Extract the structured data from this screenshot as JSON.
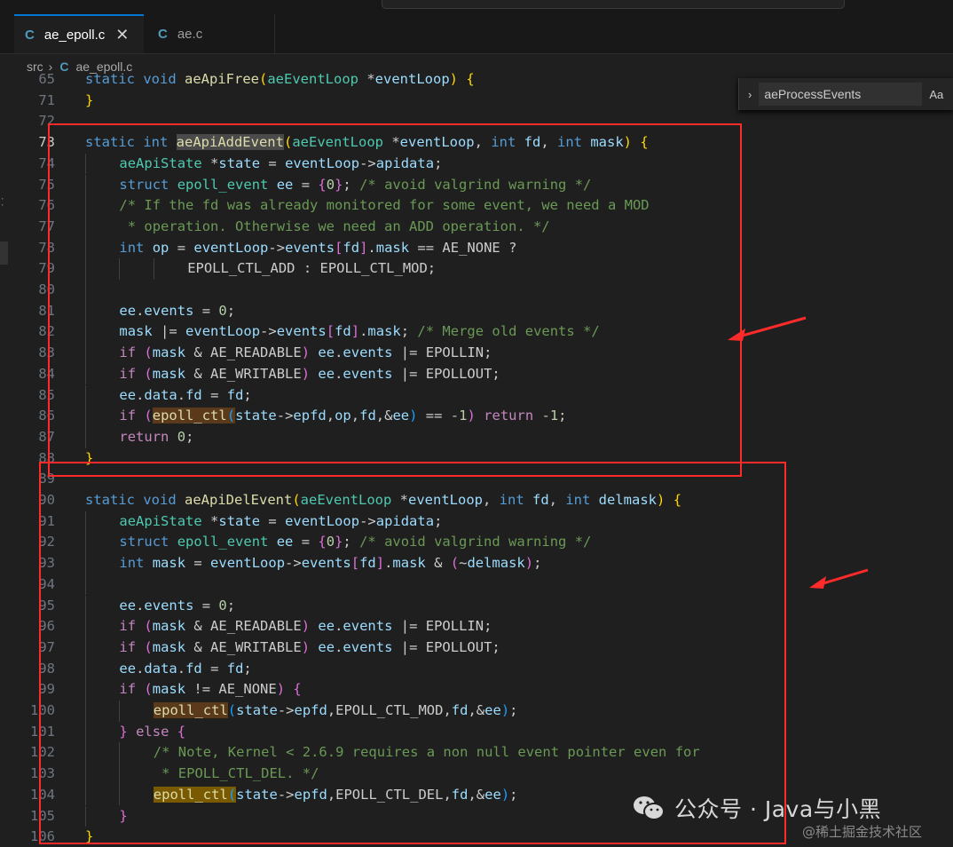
{
  "tabs": [
    {
      "icon": "C",
      "label": "ae_epoll.c",
      "close": "✕"
    },
    {
      "icon": "C",
      "label": "ae.c"
    }
  ],
  "breadcrumb": {
    "folder": "src",
    "file_icon": "C",
    "file": "ae_epoll.c"
  },
  "find_widget": {
    "value": "aeProcessEvents",
    "option": "Aa"
  },
  "watermark": {
    "text": "公众号 · Java与小黑",
    "sub": "@稀土掘金技术社区"
  },
  "colors": {
    "highlight_box": "#ff2b2b",
    "accent": "#0078d4"
  },
  "lines": [
    {
      "n": "65",
      "t": [
        [
          "kw",
          "static "
        ],
        [
          "kw",
          "void "
        ],
        [
          "fn",
          "aeApiFree"
        ],
        [
          "br1",
          "("
        ],
        [
          "ty",
          "aeEventLoop "
        ],
        [
          "ident",
          "*"
        ],
        [
          "var",
          "eventLoop"
        ],
        [
          "br1",
          ")"
        ],
        [
          "ident",
          " "
        ],
        [
          "br1",
          "{"
        ]
      ]
    },
    {
      "n": "71",
      "t": [
        [
          "br1",
          "}"
        ]
      ]
    },
    {
      "n": "72",
      "t": []
    },
    {
      "n": "73",
      "cur": true,
      "t": [
        [
          "kw",
          "static "
        ],
        [
          "kw",
          "int "
        ],
        [
          "fn fnhl",
          "aeApiAddEvent"
        ],
        [
          "br1",
          "("
        ],
        [
          "ty",
          "aeEventLoop "
        ],
        [
          "ident",
          "*"
        ],
        [
          "var",
          "eventLoop"
        ],
        [
          "ident",
          ", "
        ],
        [
          "kw",
          "int "
        ],
        [
          "var",
          "fd"
        ],
        [
          "ident",
          ", "
        ],
        [
          "kw",
          "int "
        ],
        [
          "var",
          "mask"
        ],
        [
          "br1",
          ")"
        ],
        [
          "ident",
          " "
        ],
        [
          "br1",
          "{"
        ]
      ]
    },
    {
      "n": "74",
      "i": 1,
      "t": [
        [
          "ty",
          "aeApiState "
        ],
        [
          "ident",
          "*"
        ],
        [
          "var",
          "state"
        ],
        [
          "ident",
          " = "
        ],
        [
          "var",
          "eventLoop"
        ],
        [
          "ident",
          "->"
        ],
        [
          "var",
          "apidata"
        ],
        [
          "ident",
          ";"
        ]
      ]
    },
    {
      "n": "75",
      "i": 1,
      "t": [
        [
          "kw",
          "struct "
        ],
        [
          "ty",
          "epoll_event "
        ],
        [
          "var",
          "ee"
        ],
        [
          "ident",
          " = "
        ],
        [
          "br2",
          "{"
        ],
        [
          "num",
          "0"
        ],
        [
          "br2",
          "}"
        ],
        [
          "ident",
          "; "
        ],
        [
          "cm",
          "/* avoid valgrind warning */"
        ]
      ]
    },
    {
      "n": "76",
      "i": 1,
      "t": [
        [
          "cm",
          "/* If the fd was already monitored for some event, we need a MOD"
        ]
      ]
    },
    {
      "n": "77",
      "i": 1,
      "t": [
        [
          "cm",
          " * operation. Otherwise we need an ADD operation. */"
        ]
      ]
    },
    {
      "n": "78",
      "i": 1,
      "t": [
        [
          "kw",
          "int "
        ],
        [
          "var",
          "op"
        ],
        [
          "ident",
          " = "
        ],
        [
          "var",
          "eventLoop"
        ],
        [
          "ident",
          "->"
        ],
        [
          "var",
          "events"
        ],
        [
          "br2",
          "["
        ],
        [
          "var",
          "fd"
        ],
        [
          "br2",
          "]"
        ],
        [
          "ident",
          "."
        ],
        [
          "var",
          "mask"
        ],
        [
          "ident",
          " == AE_NONE ?"
        ]
      ]
    },
    {
      "n": "79",
      "i": 3,
      "t": [
        [
          "ident",
          "EPOLL_CTL_ADD : EPOLL_CTL_MOD;"
        ]
      ]
    },
    {
      "n": "80",
      "i": 1,
      "t": []
    },
    {
      "n": "81",
      "i": 1,
      "t": [
        [
          "var",
          "ee"
        ],
        [
          "ident",
          "."
        ],
        [
          "var",
          "events"
        ],
        [
          "ident",
          " = "
        ],
        [
          "num",
          "0"
        ],
        [
          "ident",
          ";"
        ]
      ]
    },
    {
      "n": "82",
      "i": 1,
      "t": [
        [
          "var",
          "mask"
        ],
        [
          "ident",
          " |= "
        ],
        [
          "var",
          "eventLoop"
        ],
        [
          "ident",
          "->"
        ],
        [
          "var",
          "events"
        ],
        [
          "br2",
          "["
        ],
        [
          "var",
          "fd"
        ],
        [
          "br2",
          "]"
        ],
        [
          "ident",
          "."
        ],
        [
          "var",
          "mask"
        ],
        [
          "ident",
          "; "
        ],
        [
          "cm",
          "/* Merge old events */"
        ]
      ]
    },
    {
      "n": "83",
      "i": 1,
      "t": [
        [
          "ctl",
          "if "
        ],
        [
          "br2",
          "("
        ],
        [
          "var",
          "mask"
        ],
        [
          "ident",
          " & AE_READABLE"
        ],
        [
          "br2",
          ")"
        ],
        [
          "ident",
          " "
        ],
        [
          "var",
          "ee"
        ],
        [
          "ident",
          "."
        ],
        [
          "var",
          "events"
        ],
        [
          "ident",
          " |= EPOLLIN;"
        ]
      ]
    },
    {
      "n": "84",
      "i": 1,
      "t": [
        [
          "ctl",
          "if "
        ],
        [
          "br2",
          "("
        ],
        [
          "var",
          "mask"
        ],
        [
          "ident",
          " & AE_WRITABLE"
        ],
        [
          "br2",
          ")"
        ],
        [
          "ident",
          " "
        ],
        [
          "var",
          "ee"
        ],
        [
          "ident",
          "."
        ],
        [
          "var",
          "events"
        ],
        [
          "ident",
          " |= EPOLLOUT;"
        ]
      ]
    },
    {
      "n": "85",
      "i": 1,
      "t": [
        [
          "var",
          "ee"
        ],
        [
          "ident",
          "."
        ],
        [
          "var",
          "data"
        ],
        [
          "ident",
          "."
        ],
        [
          "var",
          "fd"
        ],
        [
          "ident",
          " = "
        ],
        [
          "var",
          "fd"
        ],
        [
          "ident",
          ";"
        ]
      ]
    },
    {
      "n": "86",
      "i": 1,
      "t": [
        [
          "ctl",
          "if "
        ],
        [
          "br2",
          "("
        ],
        [
          "fn brown",
          "epoll_ctl"
        ],
        [
          "br3 brown",
          "("
        ],
        [
          "var",
          "state"
        ],
        [
          "ident",
          "->"
        ],
        [
          "var",
          "epfd"
        ],
        [
          "ident",
          ","
        ],
        [
          "var",
          "op"
        ],
        [
          "ident",
          ","
        ],
        [
          "var",
          "fd"
        ],
        [
          "ident",
          ",&"
        ],
        [
          "var",
          "ee"
        ],
        [
          "br3",
          ")"
        ],
        [
          "ident",
          " == "
        ],
        [
          "num",
          "-1"
        ],
        [
          "br2",
          ")"
        ],
        [
          "ident",
          " "
        ],
        [
          "ctl",
          "return "
        ],
        [
          "num",
          "-1"
        ],
        [
          "ident",
          ";"
        ]
      ]
    },
    {
      "n": "87",
      "i": 1,
      "t": [
        [
          "ctl",
          "return "
        ],
        [
          "num",
          "0"
        ],
        [
          "ident",
          ";"
        ]
      ]
    },
    {
      "n": "88",
      "t": [
        [
          "br1",
          "}"
        ]
      ]
    },
    {
      "n": "89",
      "t": []
    },
    {
      "n": "90",
      "t": [
        [
          "kw",
          "static "
        ],
        [
          "kw",
          "void "
        ],
        [
          "fn",
          "aeApiDelEvent"
        ],
        [
          "br1",
          "("
        ],
        [
          "ty",
          "aeEventLoop "
        ],
        [
          "ident",
          "*"
        ],
        [
          "var",
          "eventLoop"
        ],
        [
          "ident",
          ", "
        ],
        [
          "kw",
          "int "
        ],
        [
          "var",
          "fd"
        ],
        [
          "ident",
          ", "
        ],
        [
          "kw",
          "int "
        ],
        [
          "var",
          "delmask"
        ],
        [
          "br1",
          ")"
        ],
        [
          "ident",
          " "
        ],
        [
          "br1",
          "{"
        ]
      ]
    },
    {
      "n": "91",
      "i": 1,
      "t": [
        [
          "ty",
          "aeApiState "
        ],
        [
          "ident",
          "*"
        ],
        [
          "var",
          "state"
        ],
        [
          "ident",
          " = "
        ],
        [
          "var",
          "eventLoop"
        ],
        [
          "ident",
          "->"
        ],
        [
          "var",
          "apidata"
        ],
        [
          "ident",
          ";"
        ]
      ]
    },
    {
      "n": "92",
      "i": 1,
      "t": [
        [
          "kw",
          "struct "
        ],
        [
          "ty",
          "epoll_event "
        ],
        [
          "var",
          "ee"
        ],
        [
          "ident",
          " = "
        ],
        [
          "br2",
          "{"
        ],
        [
          "num",
          "0"
        ],
        [
          "br2",
          "}"
        ],
        [
          "ident",
          "; "
        ],
        [
          "cm",
          "/* avoid valgrind warning */"
        ]
      ]
    },
    {
      "n": "93",
      "i": 1,
      "t": [
        [
          "kw",
          "int "
        ],
        [
          "var",
          "mask"
        ],
        [
          "ident",
          " = "
        ],
        [
          "var",
          "eventLoop"
        ],
        [
          "ident",
          "->"
        ],
        [
          "var",
          "events"
        ],
        [
          "br2",
          "["
        ],
        [
          "var",
          "fd"
        ],
        [
          "br2",
          "]"
        ],
        [
          "ident",
          "."
        ],
        [
          "var",
          "mask"
        ],
        [
          "ident",
          " & "
        ],
        [
          "br2",
          "("
        ],
        [
          "ident",
          "~"
        ],
        [
          "var",
          "delmask"
        ],
        [
          "br2",
          ")"
        ],
        [
          "ident",
          ";"
        ]
      ]
    },
    {
      "n": "94",
      "i": 1,
      "t": []
    },
    {
      "n": "95",
      "i": 1,
      "t": [
        [
          "var",
          "ee"
        ],
        [
          "ident",
          "."
        ],
        [
          "var",
          "events"
        ],
        [
          "ident",
          " = "
        ],
        [
          "num",
          "0"
        ],
        [
          "ident",
          ";"
        ]
      ]
    },
    {
      "n": "96",
      "i": 1,
      "t": [
        [
          "ctl",
          "if "
        ],
        [
          "br2",
          "("
        ],
        [
          "var",
          "mask"
        ],
        [
          "ident",
          " & AE_READABLE"
        ],
        [
          "br2",
          ")"
        ],
        [
          "ident",
          " "
        ],
        [
          "var",
          "ee"
        ],
        [
          "ident",
          "."
        ],
        [
          "var",
          "events"
        ],
        [
          "ident",
          " |= EPOLLIN;"
        ]
      ]
    },
    {
      "n": "97",
      "i": 1,
      "t": [
        [
          "ctl",
          "if "
        ],
        [
          "br2",
          "("
        ],
        [
          "var",
          "mask"
        ],
        [
          "ident",
          " & AE_WRITABLE"
        ],
        [
          "br2",
          ")"
        ],
        [
          "ident",
          " "
        ],
        [
          "var",
          "ee"
        ],
        [
          "ident",
          "."
        ],
        [
          "var",
          "events"
        ],
        [
          "ident",
          " |= EPOLLOUT;"
        ]
      ]
    },
    {
      "n": "98",
      "i": 1,
      "t": [
        [
          "var",
          "ee"
        ],
        [
          "ident",
          "."
        ],
        [
          "var",
          "data"
        ],
        [
          "ident",
          "."
        ],
        [
          "var",
          "fd"
        ],
        [
          "ident",
          " = "
        ],
        [
          "var",
          "fd"
        ],
        [
          "ident",
          ";"
        ]
      ]
    },
    {
      "n": "99",
      "i": 1,
      "t": [
        [
          "ctl",
          "if "
        ],
        [
          "br2",
          "("
        ],
        [
          "var",
          "mask"
        ],
        [
          "ident",
          " != AE_NONE"
        ],
        [
          "br2",
          ")"
        ],
        [
          "ident",
          " "
        ],
        [
          "br2",
          "{"
        ]
      ]
    },
    {
      "n": "100",
      "i": 2,
      "t": [
        [
          "fn brown",
          "epoll_ctl"
        ],
        [
          "br3",
          "("
        ],
        [
          "var",
          "state"
        ],
        [
          "ident",
          "->"
        ],
        [
          "var",
          "epfd"
        ],
        [
          "ident",
          ",EPOLL_CTL_MOD,"
        ],
        [
          "var",
          "fd"
        ],
        [
          "ident",
          ",&"
        ],
        [
          "var",
          "ee"
        ],
        [
          "br3",
          ")"
        ],
        [
          "ident",
          ";"
        ]
      ]
    },
    {
      "n": "101",
      "i": 1,
      "t": [
        [
          "br2",
          "}"
        ],
        [
          "ident",
          " "
        ],
        [
          "ctl",
          "else "
        ],
        [
          "br2",
          "{"
        ]
      ]
    },
    {
      "n": "102",
      "i": 2,
      "t": [
        [
          "cm",
          "/* Note, Kernel < 2.6.9 requires a non null event pointer even for"
        ]
      ]
    },
    {
      "n": "103",
      "i": 2,
      "t": [
        [
          "cm",
          " * EPOLL_CTL_DEL. */"
        ]
      ]
    },
    {
      "n": "104",
      "i": 2,
      "t": [
        [
          "fn goldbg",
          "epoll_ctl"
        ],
        [
          "br3 goldbg",
          "("
        ],
        [
          "var",
          "state"
        ],
        [
          "ident",
          "->"
        ],
        [
          "var",
          "epfd"
        ],
        [
          "ident",
          ",EPOLL_CTL_DEL,"
        ],
        [
          "var",
          "fd"
        ],
        [
          "ident",
          ",&"
        ],
        [
          "var",
          "ee"
        ],
        [
          "br3",
          ")"
        ],
        [
          "ident",
          ";"
        ]
      ]
    },
    {
      "n": "105",
      "i": 1,
      "t": [
        [
          "br2",
          "}"
        ]
      ]
    },
    {
      "n": "106",
      "t": [
        [
          "br1",
          "}"
        ]
      ]
    }
  ]
}
